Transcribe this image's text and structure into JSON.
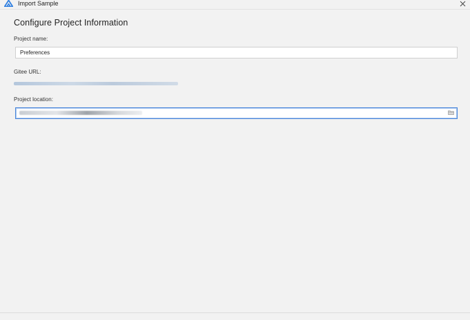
{
  "window": {
    "title": "Import Sample"
  },
  "page": {
    "heading": "Configure Project Information"
  },
  "fields": {
    "project_name": {
      "label": "Project name:",
      "value": "Preferences"
    },
    "gitee_url": {
      "label": "Gitee URL:"
    },
    "project_location": {
      "label": "Project location:",
      "browse_icon": "folder-icon"
    }
  },
  "colors": {
    "accent": "#4a86d9",
    "app_icon": "#2f7fe0",
    "background": "#f2f2f2"
  }
}
